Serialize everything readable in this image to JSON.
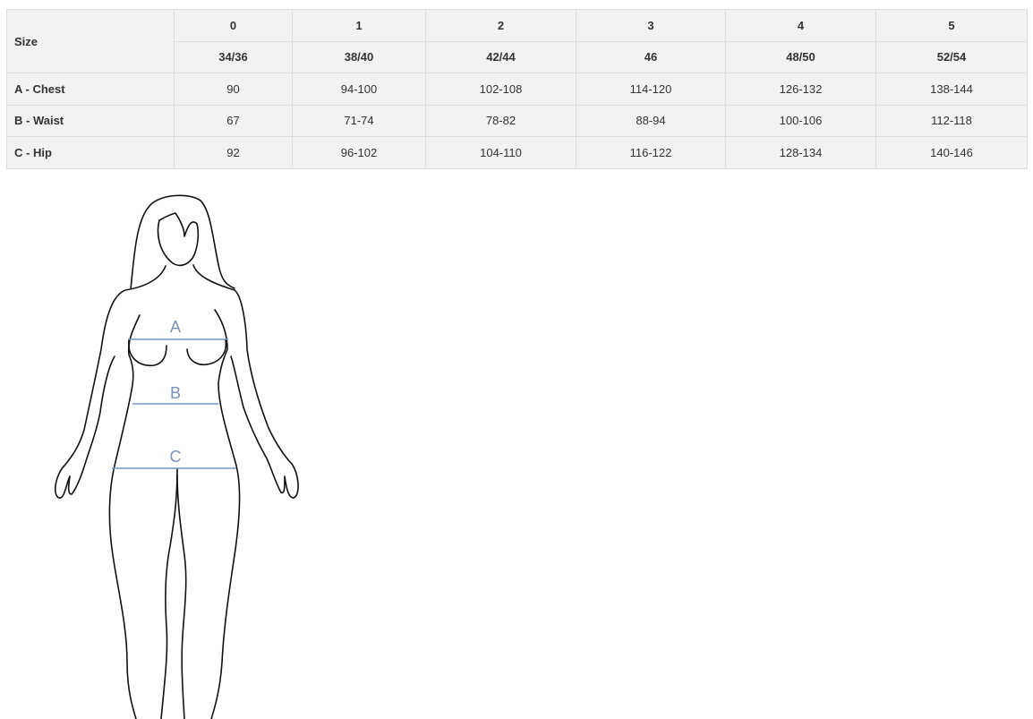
{
  "table": {
    "size_label": "Size",
    "size_numbers": [
      "0",
      "1",
      "2",
      "3",
      "4",
      "5"
    ],
    "size_eu": [
      "34/36",
      "38/40",
      "42/44",
      "46",
      "48/50",
      "52/54"
    ],
    "rows": [
      {
        "label": "A - Chest",
        "values": [
          "90",
          "94-100",
          "102-108",
          "114-120",
          "126-132",
          "138-144"
        ]
      },
      {
        "label": "B - Waist",
        "values": [
          "67",
          "71-74",
          "78-82",
          "88-94",
          "100-106",
          "112-118"
        ]
      },
      {
        "label": "C - Hip",
        "values": [
          "92",
          "96-102",
          "104-110",
          "116-122",
          "128-134",
          "140-146"
        ]
      }
    ]
  },
  "figure": {
    "markers": {
      "a": "A",
      "b": "B",
      "c": "C"
    },
    "line_color": "#7b93bd"
  }
}
